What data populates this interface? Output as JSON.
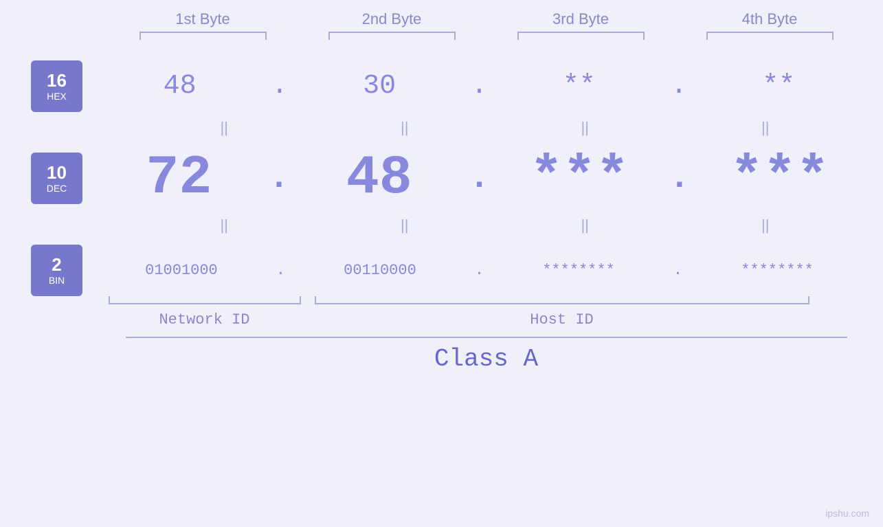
{
  "headers": {
    "byte1": "1st Byte",
    "byte2": "2nd Byte",
    "byte3": "3rd Byte",
    "byte4": "4th Byte"
  },
  "badges": {
    "hex": {
      "number": "16",
      "label": "HEX"
    },
    "dec": {
      "number": "10",
      "label": "DEC"
    },
    "bin": {
      "number": "2",
      "label": "BIN"
    }
  },
  "hex_row": {
    "b1": "48",
    "b2": "30",
    "b3": "**",
    "b4": "**",
    "dots": [
      ".",
      ".",
      ".",
      "."
    ]
  },
  "dec_row": {
    "b1": "72",
    "b2": "48",
    "b3": "***",
    "b4": "***",
    "dots": [
      ".",
      ".",
      ".",
      "."
    ]
  },
  "bin_row": {
    "b1": "01001000",
    "b2": "00110000",
    "b3": "********",
    "b4": "********",
    "dots": [
      ".",
      ".",
      ".",
      "."
    ]
  },
  "labels": {
    "network_id": "Network ID",
    "host_id": "Host ID",
    "class": "Class A"
  },
  "watermark": "ipshu.com"
}
